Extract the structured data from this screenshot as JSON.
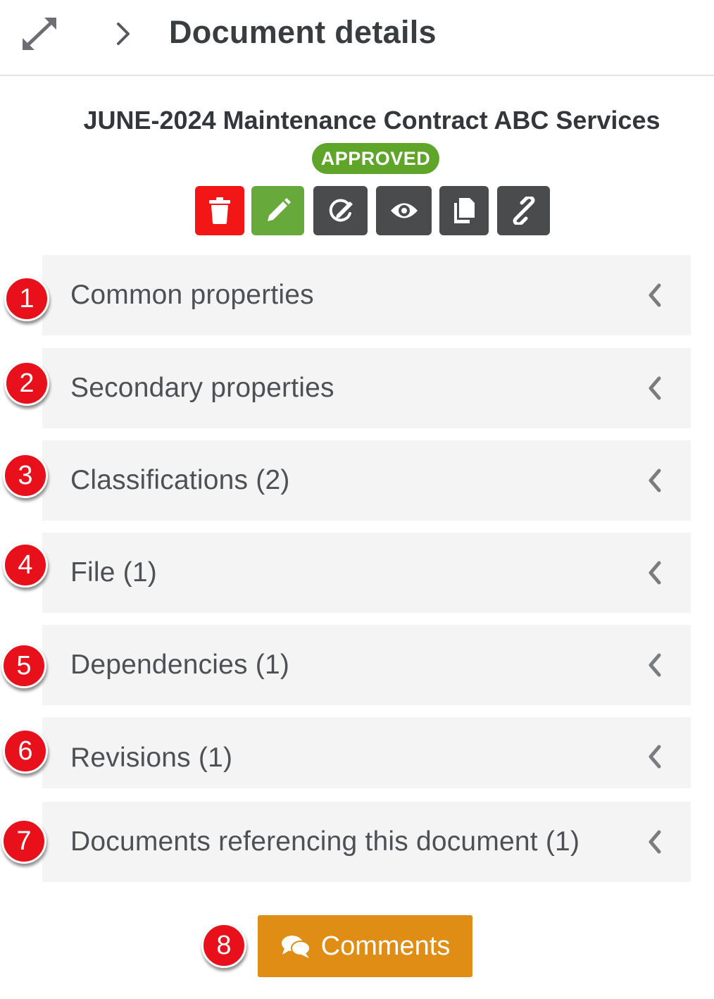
{
  "header": {
    "title": "Document details",
    "expand_icon": "expand-arrows-icon",
    "breadcrumb_icon": "chevron-right-icon"
  },
  "document": {
    "title": "JUNE-2024 Maintenance Contract ABC Services",
    "status": "APPROVED",
    "status_color": "#5fa52a"
  },
  "toolbar": {
    "buttons": [
      {
        "name": "delete",
        "icon": "trash-icon",
        "color": "#f21616"
      },
      {
        "name": "edit",
        "icon": "pencil-icon",
        "color": "#67a93a"
      },
      {
        "name": "sign",
        "icon": "signature-icon",
        "color": "#4a4b4c"
      },
      {
        "name": "view",
        "icon": "eye-icon",
        "color": "#4a4b4c"
      },
      {
        "name": "copy",
        "icon": "copy-icon",
        "color": "#4a4b4c"
      },
      {
        "name": "link",
        "icon": "link-icon",
        "color": "#4a4b4c"
      }
    ]
  },
  "sections": [
    {
      "number": "1",
      "label": "Common properties"
    },
    {
      "number": "2",
      "label": "Secondary properties"
    },
    {
      "number": "3",
      "label": "Classifications (2)"
    },
    {
      "number": "4",
      "label": "File (1)"
    },
    {
      "number": "5",
      "label": "Dependencies (1)"
    },
    {
      "number": "6",
      "label": "Revisions (1)"
    },
    {
      "number": "7",
      "label": "Documents referencing this document (1)"
    }
  ],
  "comments": {
    "number": "8",
    "label": "Comments",
    "icon": "comments-icon",
    "color": "#e08d15"
  },
  "colors": {
    "marker": "#e8101a",
    "section_bg": "#f4f4f4"
  }
}
